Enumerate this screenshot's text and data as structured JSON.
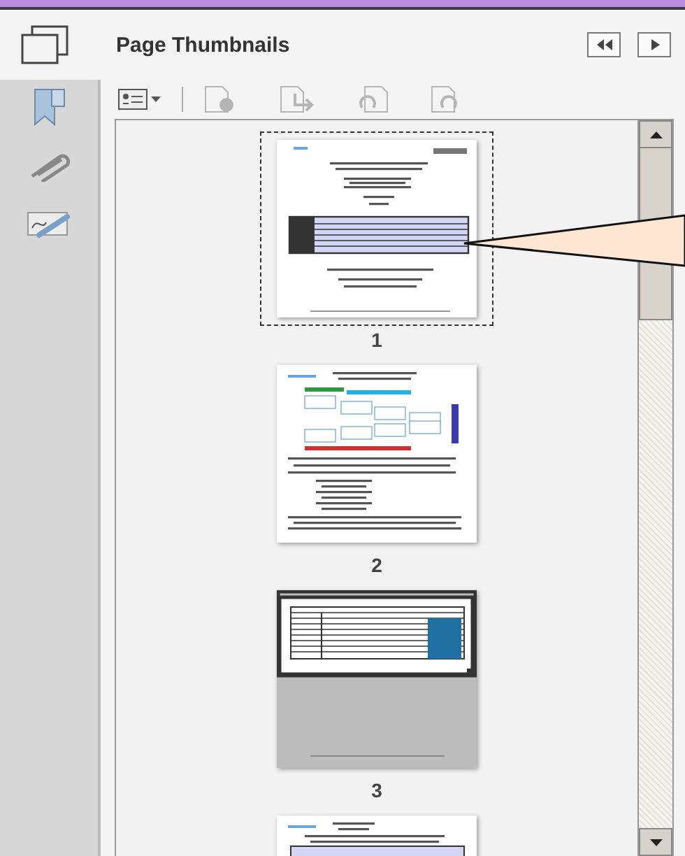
{
  "panel": {
    "title": "Page Thumbnails"
  },
  "nav_buttons": [
    {
      "kind": "collapse"
    },
    {
      "kind": "expand"
    }
  ],
  "sidebar": [
    {
      "kind": "bookmark"
    },
    {
      "kind": "attachment"
    },
    {
      "kind": "signature"
    }
  ],
  "toolbar": [
    {
      "kind": "options",
      "disabled": false
    },
    {
      "kind": "delete",
      "disabled": true
    },
    {
      "kind": "insert",
      "disabled": true
    },
    {
      "kind": "rotate-left",
      "disabled": true
    },
    {
      "kind": "rotate-right",
      "disabled": true
    }
  ],
  "thumbnails": [
    {
      "label": "1",
      "kind": "cover",
      "selected": true,
      "current": false
    },
    {
      "label": "2",
      "kind": "flowchart",
      "selected": false,
      "current": false
    },
    {
      "label": "3",
      "kind": "table",
      "selected": false,
      "current": true
    },
    {
      "kind": "form",
      "selected": false,
      "current": false
    }
  ]
}
